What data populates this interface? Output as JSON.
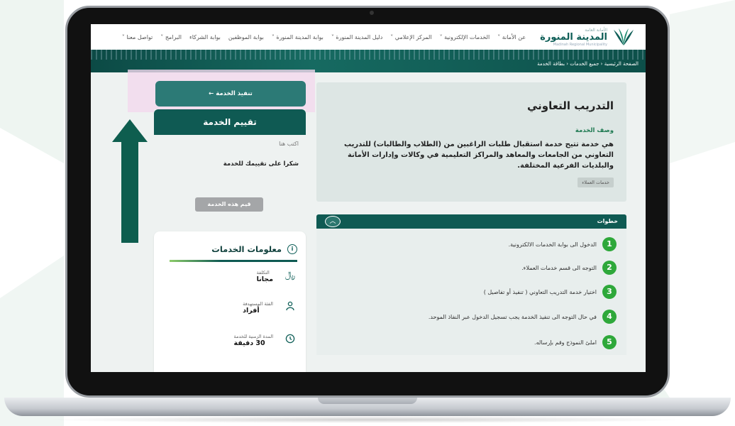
{
  "nav": {
    "logo_sub": "الأمانة العامة",
    "logo_main": "المدينة المنورة",
    "logo_en": "Madinah Regional Municipality",
    "items": [
      "عن الأمانة ˅",
      "الخدمات الإلكترونية ˅",
      "المركز الإعلامي ˅",
      "دليل المدينة المنورة ˅",
      "بوابة المدينة المنورة ˅",
      "بوابة الموظفين",
      "بوابة الشركاء",
      "البرامج ˅",
      "تواصل معنا ˅"
    ]
  },
  "breadcrumb": "الصفحة الرئيسية ‹ جميع الخدمات ‹ بطاقة الخدمة",
  "service": {
    "title": "التدريب التعاوني",
    "desc_label": "وصف الخدمة",
    "description": "هي خدمة تتيح خدمة استقبال طلبات الراغبين من (الطلاب والطالبات) للتدريب التعاوني من الجامعات والمعاهد والمراكز التعليمية في وكالات وإدارات الأمانة والبلديات الفرعية المختلفة.",
    "tag": "خدمات العملاء"
  },
  "steps": {
    "title": "خطوات",
    "collapse_icon": "chevron-up",
    "items": [
      {
        "num": "1",
        "text": "الدخول الى بوابة الخدمات الالكترونية."
      },
      {
        "num": "2",
        "text": "التوجه الى قسم خدمات العملاء."
      },
      {
        "num": "3",
        "text": "اختيار خدمة التدريب التعاوني ( تنفيذ أو تفاصيل )"
      },
      {
        "num": "4",
        "text": "في حال التوجه الى تنفيذ الخدمة يجب تسجيل الدخول عبر النفاذ الموحد."
      },
      {
        "num": "5",
        "text": "املئ النموذج وقم بإرساله."
      }
    ]
  },
  "execute_button": "تنفيذ الخدمة ←",
  "rating": {
    "title": "تقييم الخدمة",
    "write_here": "اكتب هنا",
    "thanks": "شكرا على تقييمك للخدمة",
    "button": "قيم هذه الخدمة"
  },
  "info": {
    "title": "معلومات الخدمات",
    "rows": [
      {
        "label": "التكلفة",
        "value": "مجانا",
        "icon": "riyal-icon"
      },
      {
        "label": "الفئة المستهدفة",
        "value": "أفراد",
        "icon": "person-icon"
      },
      {
        "label": "المدة الزمنية للخدمة",
        "value": "30 دقيقة",
        "icon": "clock-icon"
      }
    ]
  },
  "colors": {
    "primary": "#0f5a53",
    "accent": "#2ea83a",
    "arrow": "#0e5e4f",
    "highlight": "#f2d8ee"
  }
}
